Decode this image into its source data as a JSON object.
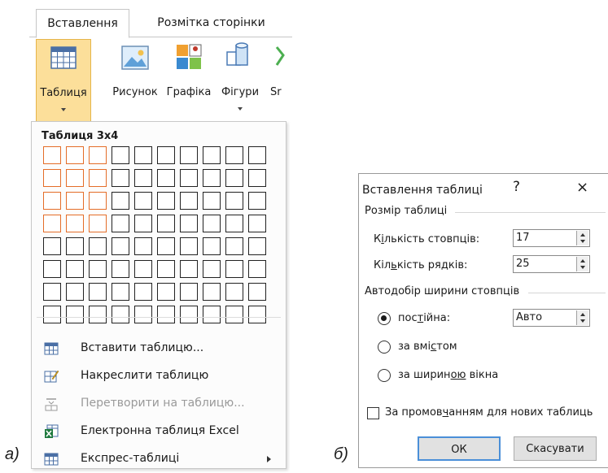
{
  "ribbon": {
    "tabs": [
      "Вставлення",
      "Розмітка сторінки"
    ],
    "commands": {
      "table": "Таблиця",
      "picture": "Рисунок",
      "graphics": "Графіка",
      "shapes": "Фігури",
      "smartart": "Sr"
    },
    "accent": "#fcdf9a"
  },
  "table_menu": {
    "title": "Таблиця 3x4",
    "grid": {
      "columns": 10,
      "rows": 8,
      "selected_columns": 3,
      "selected_rows": 4,
      "highlight_color": "#e46d28"
    },
    "items": [
      {
        "label": "Вставити таблицю...",
        "icon": "table-grid-icon",
        "enabled": true
      },
      {
        "label": "Накреслити таблицю",
        "icon": "draw-table-icon",
        "enabled": true
      },
      {
        "label": "Перетворити на таблицю...",
        "icon": "convert-text-icon",
        "enabled": false
      },
      {
        "label": "Електронна таблиця Excel",
        "icon": "excel-icon",
        "enabled": true
      },
      {
        "label": "Експрес-таблиці",
        "icon": "quick-tables-icon",
        "enabled": true
      }
    ]
  },
  "captions": {
    "left": "а)",
    "right": "б)"
  },
  "dialog": {
    "title": "Вставлення таблиці",
    "help": "?",
    "close": "×",
    "size_group": "Розмір таблиці",
    "columns_label": "Кількість стовпців:",
    "columns_value": "17",
    "rows_label": "Кількість рядків:",
    "rows_value": "25",
    "autofit_group": "Автодобір ширини стовпців",
    "fixed_label": "постійна:",
    "fixed_value": "Авто",
    "contents_label": "за вмістом",
    "window_label": "за шириною вікна",
    "remember_label": "За промовчанням для нових таблиць",
    "ok": "ОК",
    "cancel": "Скасувати"
  }
}
